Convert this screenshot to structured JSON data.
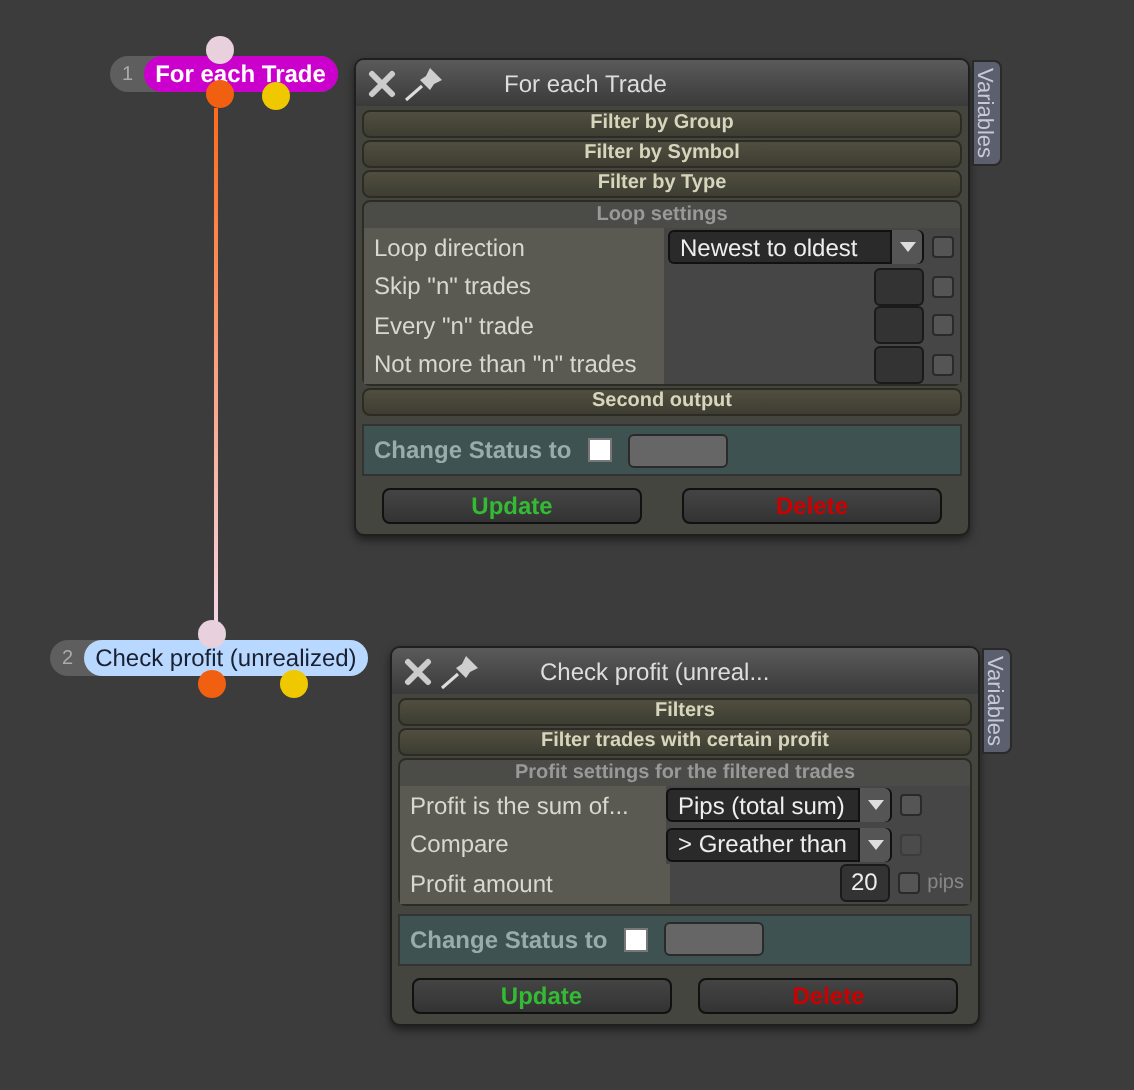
{
  "blocks": [
    {
      "number": "1",
      "label": "For each Trade",
      "color": "#cc00cc",
      "panel": {
        "title": "For each Trade",
        "side_tab": "Variables",
        "sections": [
          "Filter by Group",
          "Filter by Symbol",
          "Filter by Type"
        ],
        "settings_title": "Loop settings",
        "settings": [
          {
            "label": "Loop direction",
            "kind": "select",
            "value": "Newest to oldest",
            "checked": false,
            "disabled": false
          },
          {
            "label": "Skip \"n\" trades",
            "kind": "number",
            "checked": false,
            "disabled": false
          },
          {
            "label": "Every \"n\" trade",
            "kind": "number",
            "checked": false,
            "disabled": false
          },
          {
            "label": "Not more than \"n\" trades",
            "kind": "number",
            "checked": false,
            "disabled": false
          }
        ],
        "after_sections": [
          "Second output"
        ],
        "status_label": "Change Status to",
        "status_checked": false,
        "buttons": [
          {
            "label": "Update",
            "kind": "update"
          },
          {
            "label": "Delete",
            "kind": "delete"
          }
        ]
      }
    },
    {
      "number": "2",
      "label": "Check profit (unrealized)",
      "color": "#b8d8ff",
      "panel": {
        "title": "Check profit (unreal...",
        "side_tab": "Variables",
        "sections": [
          "Filters",
          "Filter trades with certain profit"
        ],
        "settings_title": "Profit settings for the filtered trades",
        "settings": [
          {
            "label": "Profit is the sum of...",
            "kind": "select",
            "value": "Pips (total sum)",
            "checked": false,
            "disabled": false
          },
          {
            "label": "Compare",
            "kind": "select",
            "value": "> Greather than",
            "checked": false,
            "disabled": true
          },
          {
            "label": "Profit amount",
            "kind": "number",
            "value": "20",
            "checked": false,
            "disabled": false,
            "unit": "pips"
          }
        ],
        "status_label": "Change Status to",
        "status_checked": false,
        "buttons": [
          {
            "label": "Update",
            "kind": "update"
          },
          {
            "label": "Delete",
            "kind": "delete"
          }
        ]
      }
    }
  ]
}
